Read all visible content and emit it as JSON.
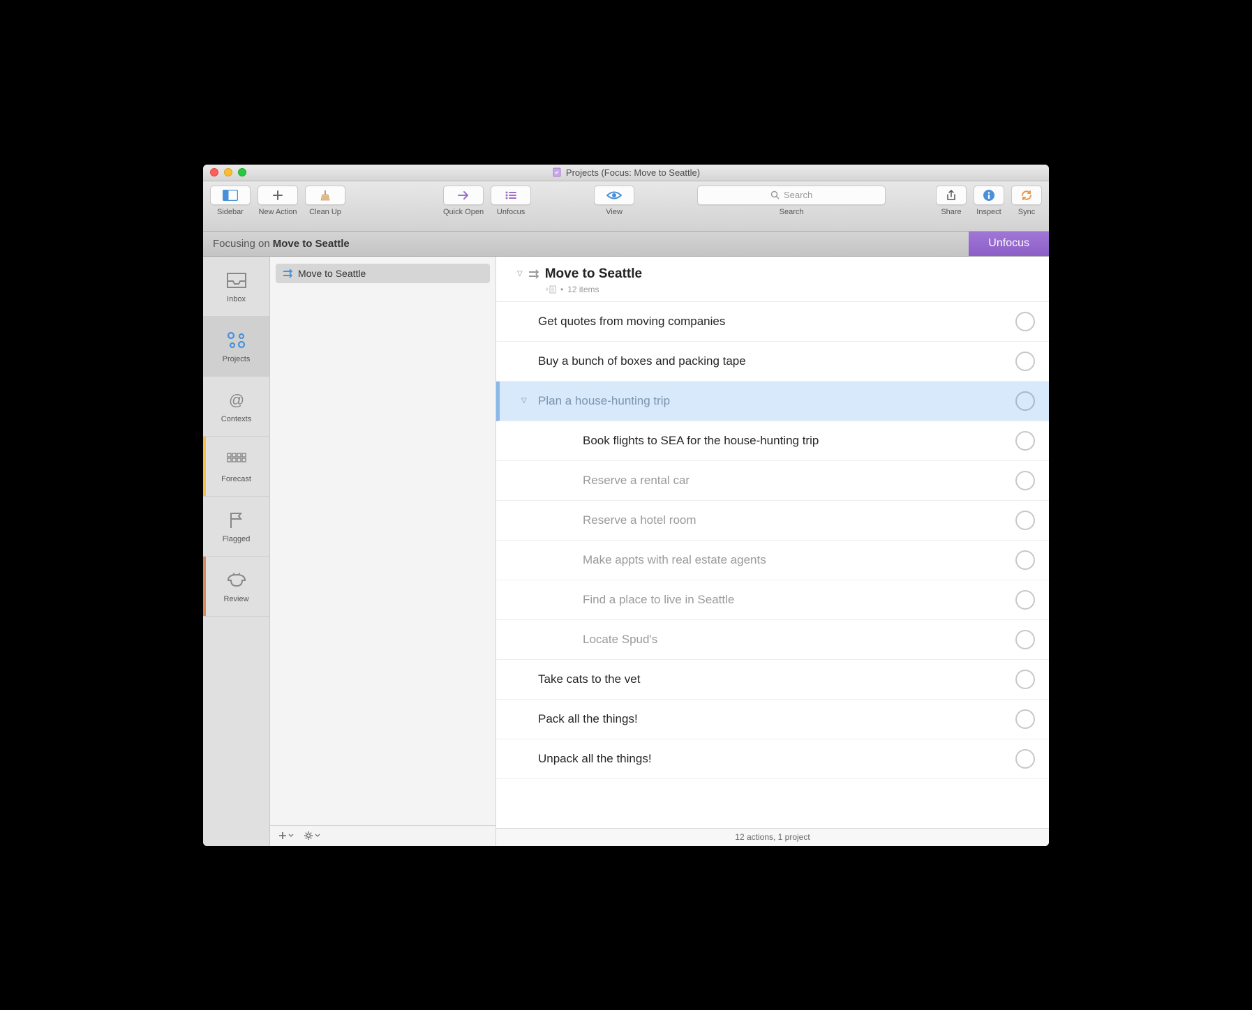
{
  "window": {
    "title": "Projects (Focus: Move to Seattle)"
  },
  "toolbar": {
    "sidebar": "Sidebar",
    "new_action": "New Action",
    "clean_up": "Clean Up",
    "quick_open": "Quick Open",
    "unfocus": "Unfocus",
    "view": "View",
    "search_label": "Search",
    "search_placeholder": "Search",
    "share": "Share",
    "inspect": "Inspect",
    "sync": "Sync"
  },
  "focus_bar": {
    "prefix": "Focusing on",
    "project": "Move to Seattle",
    "unfocus": "Unfocus"
  },
  "perspectives": [
    {
      "key": "inbox",
      "label": "Inbox"
    },
    {
      "key": "projects",
      "label": "Projects"
    },
    {
      "key": "contexts",
      "label": "Contexts"
    },
    {
      "key": "forecast",
      "label": "Forecast"
    },
    {
      "key": "flagged",
      "label": "Flagged"
    },
    {
      "key": "review",
      "label": "Review"
    }
  ],
  "sidebar": {
    "project_name": "Move to Seattle"
  },
  "outline": {
    "title": "Move to Seattle",
    "item_count": "12 items",
    "tasks": [
      {
        "title": "Get quotes from moving companies",
        "level": 1,
        "blocked": false,
        "selected": false,
        "has_children": false
      },
      {
        "title": "Buy a bunch of boxes and packing tape",
        "level": 1,
        "blocked": false,
        "selected": false,
        "has_children": false
      },
      {
        "title": "Plan a house-hunting trip",
        "level": 1,
        "blocked": false,
        "selected": true,
        "has_children": true
      },
      {
        "title": "Book flights to SEA for the house-hunting trip",
        "level": 2,
        "blocked": false,
        "selected": false,
        "has_children": false
      },
      {
        "title": "Reserve a rental car",
        "level": 2,
        "blocked": true,
        "selected": false,
        "has_children": false
      },
      {
        "title": "Reserve a hotel room",
        "level": 2,
        "blocked": true,
        "selected": false,
        "has_children": false
      },
      {
        "title": "Make appts with real estate agents",
        "level": 2,
        "blocked": true,
        "selected": false,
        "has_children": false
      },
      {
        "title": "Find a place to live in Seattle",
        "level": 2,
        "blocked": true,
        "selected": false,
        "has_children": false
      },
      {
        "title": "Locate Spud's",
        "level": 2,
        "blocked": true,
        "selected": false,
        "has_children": false
      },
      {
        "title": "Take cats to the vet",
        "level": 1,
        "blocked": false,
        "selected": false,
        "has_children": false
      },
      {
        "title": "Pack all the things!",
        "level": 1,
        "blocked": false,
        "selected": false,
        "has_children": false
      },
      {
        "title": "Unpack all the things!",
        "level": 1,
        "blocked": false,
        "selected": false,
        "has_children": false
      }
    ]
  },
  "status_bar": {
    "text": "12 actions, 1 project"
  },
  "colors": {
    "accent_purple": "#8c5fc7",
    "accent_blue": "#4a90d9",
    "selection": "#d7e9fb"
  }
}
